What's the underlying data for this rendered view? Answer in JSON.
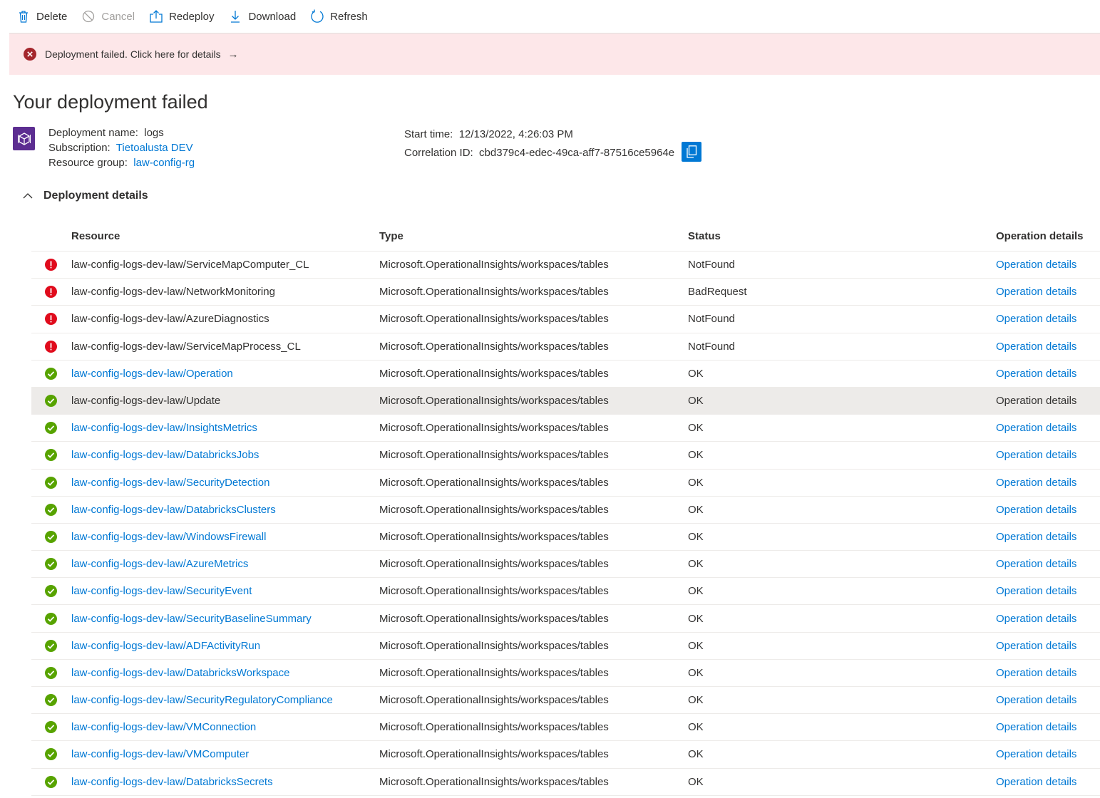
{
  "toolbar": {
    "delete": "Delete",
    "cancel": "Cancel",
    "redeploy": "Redeploy",
    "download": "Download",
    "refresh": "Refresh"
  },
  "banner": {
    "text": "Deployment failed. Click here for details",
    "arrow": "→"
  },
  "title": "Your deployment failed",
  "summary": {
    "deployment_name_label": "Deployment name:",
    "deployment_name": "logs",
    "subscription_label": "Subscription:",
    "subscription": "Tietoalusta DEV",
    "resource_group_label": "Resource group:",
    "resource_group": "law-config-rg",
    "start_time_label": "Start time:",
    "start_time": "12/13/2022, 4:26:03 PM",
    "correlation_label": "Correlation ID:",
    "correlation_id": "cbd379c4-edec-49ca-aff7-87516ce5964e"
  },
  "details": {
    "heading": "Deployment details",
    "columns": [
      "Resource",
      "Type",
      "Status",
      "Operation details"
    ],
    "rows": [
      {
        "resource": "law-config-logs-dev-law/ServiceMapComputer_CL",
        "type": "Microsoft.OperationalInsights/workspaces/tables",
        "status": "NotFound",
        "op": "Operation details",
        "state": "error"
      },
      {
        "resource": "law-config-logs-dev-law/NetworkMonitoring",
        "type": "Microsoft.OperationalInsights/workspaces/tables",
        "status": "BadRequest",
        "op": "Operation details",
        "state": "error"
      },
      {
        "resource": "law-config-logs-dev-law/AzureDiagnostics",
        "type": "Microsoft.OperationalInsights/workspaces/tables",
        "status": "NotFound",
        "op": "Operation details",
        "state": "error"
      },
      {
        "resource": "law-config-logs-dev-law/ServiceMapProcess_CL",
        "type": "Microsoft.OperationalInsights/workspaces/tables",
        "status": "NotFound",
        "op": "Operation details",
        "state": "error"
      },
      {
        "resource": "law-config-logs-dev-law/Operation",
        "type": "Microsoft.OperationalInsights/workspaces/tables",
        "status": "OK",
        "op": "Operation details",
        "state": "ok"
      },
      {
        "resource": "law-config-logs-dev-law/Update",
        "type": "Microsoft.OperationalInsights/workspaces/tables",
        "status": "OK",
        "op": "Operation details",
        "state": "ok"
      },
      {
        "resource": "law-config-logs-dev-law/InsightsMetrics",
        "type": "Microsoft.OperationalInsights/workspaces/tables",
        "status": "OK",
        "op": "Operation details",
        "state": "ok"
      },
      {
        "resource": "law-config-logs-dev-law/DatabricksJobs",
        "type": "Microsoft.OperationalInsights/workspaces/tables",
        "status": "OK",
        "op": "Operation details",
        "state": "ok"
      },
      {
        "resource": "law-config-logs-dev-law/SecurityDetection",
        "type": "Microsoft.OperationalInsights/workspaces/tables",
        "status": "OK",
        "op": "Operation details",
        "state": "ok"
      },
      {
        "resource": "law-config-logs-dev-law/DatabricksClusters",
        "type": "Microsoft.OperationalInsights/workspaces/tables",
        "status": "OK",
        "op": "Operation details",
        "state": "ok"
      },
      {
        "resource": "law-config-logs-dev-law/WindowsFirewall",
        "type": "Microsoft.OperationalInsights/workspaces/tables",
        "status": "OK",
        "op": "Operation details",
        "state": "ok"
      },
      {
        "resource": "law-config-logs-dev-law/AzureMetrics",
        "type": "Microsoft.OperationalInsights/workspaces/tables",
        "status": "OK",
        "op": "Operation details",
        "state": "ok"
      },
      {
        "resource": "law-config-logs-dev-law/SecurityEvent",
        "type": "Microsoft.OperationalInsights/workspaces/tables",
        "status": "OK",
        "op": "Operation details",
        "state": "ok"
      },
      {
        "resource": "law-config-logs-dev-law/SecurityBaselineSummary",
        "type": "Microsoft.OperationalInsights/workspaces/tables",
        "status": "OK",
        "op": "Operation details",
        "state": "ok"
      },
      {
        "resource": "law-config-logs-dev-law/ADFActivityRun",
        "type": "Microsoft.OperationalInsights/workspaces/tables",
        "status": "OK",
        "op": "Operation details",
        "state": "ok"
      },
      {
        "resource": "law-config-logs-dev-law/DatabricksWorkspace",
        "type": "Microsoft.OperationalInsights/workspaces/tables",
        "status": "OK",
        "op": "Operation details",
        "state": "ok"
      },
      {
        "resource": "law-config-logs-dev-law/SecurityRegulatoryCompliance",
        "type": "Microsoft.OperationalInsights/workspaces/tables",
        "status": "OK",
        "op": "Operation details",
        "state": "ok"
      },
      {
        "resource": "law-config-logs-dev-law/VMConnection",
        "type": "Microsoft.OperationalInsights/workspaces/tables",
        "status": "OK",
        "op": "Operation details",
        "state": "ok"
      },
      {
        "resource": "law-config-logs-dev-law/VMComputer",
        "type": "Microsoft.OperationalInsights/workspaces/tables",
        "status": "OK",
        "op": "Operation details",
        "state": "ok"
      },
      {
        "resource": "law-config-logs-dev-law/DatabricksSecrets",
        "type": "Microsoft.OperationalInsights/workspaces/tables",
        "status": "OK",
        "op": "Operation details",
        "state": "ok"
      }
    ]
  },
  "colors": {
    "accent": "#0078d4",
    "error": "#d13438",
    "success": "#57a300",
    "banner_bg": "#fde7e9",
    "resource_icon_bg": "#5c2d91"
  }
}
